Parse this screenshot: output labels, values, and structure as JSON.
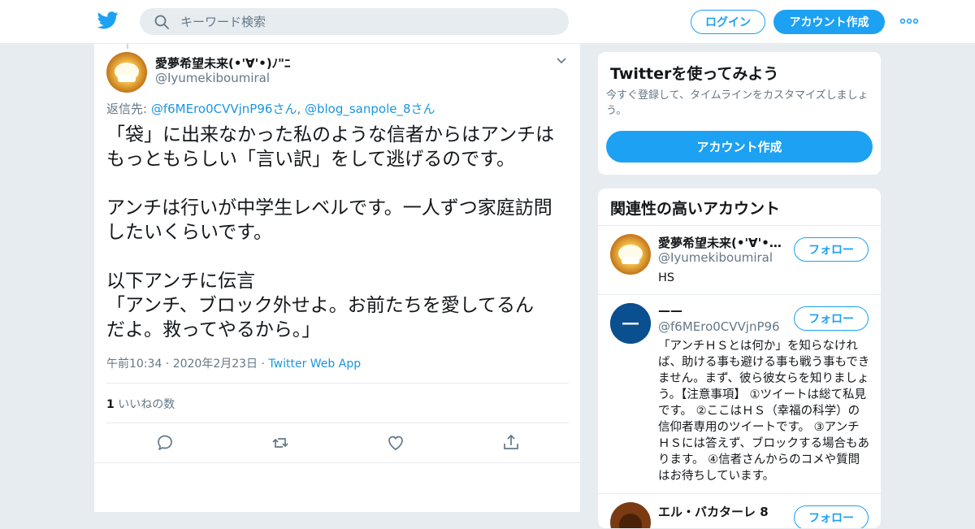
{
  "header": {
    "search_placeholder": "キーワード検索",
    "login_label": "ログイン",
    "signup_label": "アカウント作成",
    "more_icon": "more-dots-icon"
  },
  "tweet": {
    "display_name": "愛夢希望未来(•'∀'•)ﾉ\"ﾆ",
    "handle": "@Iyumekiboumiral",
    "replying_prefix": "返信先: ",
    "replying_user1": "@f6MEro0CVVjnP96さん",
    "replying_sep": ", ",
    "replying_user2": "@blog_sanpole_8さん",
    "text": "「袋」に出来なかった私のような信者からはアンチは\nもっともらしい「言い訳」をして逃げるのです。\n\nアンチは行いが中学生レベルです。一人ずつ家庭訪問\nしたいくらいです。\n\n以下アンチに伝言\n「アンチ、ブロック外せよ。お前たちを愛してるん\nだよ。救ってやるから。」",
    "timestamp": "午前10:34 · 2020年2月23日 · ",
    "source": "Twitter Web App",
    "like_count": "1",
    "like_label": " いいねの数"
  },
  "signup_card": {
    "title": "Twitterを使ってみよう",
    "description": "今すぐ登録して、タイムラインをカスタマイズしましょう。",
    "button": "アカウント作成"
  },
  "related": {
    "title": "関連性の高いアカウント",
    "follow_label": "フォロー",
    "accounts": [
      {
        "name": "愛夢希望未来(•'∀'•)…",
        "handle": "@Iyumekiboumiral",
        "bio": "HS"
      },
      {
        "name": "——",
        "handle": "@f6MEro0CVVjnP96",
        "bio": "「アンチＨＳとは何か」を知らなければ、助ける事も避ける事も戦う事もできません。まず、彼ら彼女らを知りましょう。【注意事項】 ①ツイートは総て私見です。 ②ここはＨＳ（幸福の科学）の信仰者専用のツイートです。 ③アンチＨＳには答えず、ブロックする場合もあります。 ④信者さんからのコメや質問はお待ちしています。"
      },
      {
        "name": "エル・バカターレ 8",
        "handle": "",
        "bio": ""
      }
    ]
  },
  "colors": {
    "brand": "#1da1f2",
    "link": "#1b95e0",
    "muted": "#657786",
    "background": "#e6ecf0"
  }
}
